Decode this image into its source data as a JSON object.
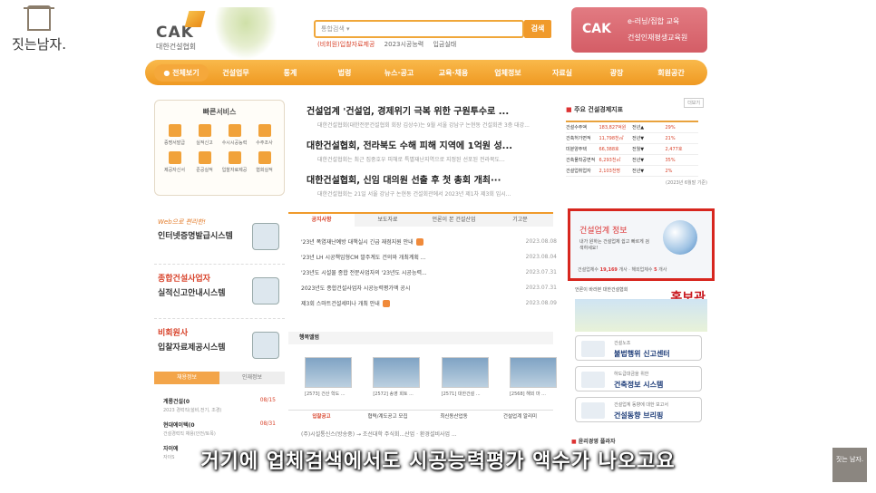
{
  "channel": {
    "name": "짓는남자.",
    "corner_label": "짓는 남자."
  },
  "header": {
    "logo_text": "CAK",
    "logo_sub": "대한건설협회",
    "search_placeholder": "통합검색 ▾",
    "search_button": "검색",
    "search_links": [
      "(비회원)입찰자료제공",
      "2023시공능력",
      "입금실태"
    ],
    "edu_banner": {
      "logo": "CAK",
      "line1": "e-러닝/집합 교육",
      "line2": "건설인재평생교육원"
    }
  },
  "nav": [
    "● 전체보기",
    "건설업무",
    "통계",
    "법령",
    "뉴스·공고",
    "교육·채용",
    "업체정보",
    "자료실",
    "광장",
    "회원공간"
  ],
  "quick_service": {
    "title": "빠른서비스",
    "items": [
      "증명서발급",
      "실적신고",
      "수시시공능력",
      "수주조사",
      "제공자신서",
      "준공실적",
      "입찰자료제공",
      "협회실적"
    ]
  },
  "news": [
    {
      "title": "건설업계 '건설업, 경제위기 극복 위한 구원투수로 ...",
      "desc": "대한건설협회(대한전문건설협회 회장 김상수)는 9월 서울 강남구 논현동 건설회관 3층 대강..."
    },
    {
      "title": "대한건설협회, 전라북도 수해 피해 지역에 1억원 성...",
      "desc": "대한건설협회는 최근 집중호우 피해로 특별재난지역으로 지정된 선포된 전라북도..."
    },
    {
      "title": "대한건설협회, 신임 대의원 선출 후 첫 총회 개최···",
      "desc": "대한건설협회는 21일 서울 강남구 논현동 건설회관에서 2023년 제1차 제3회 임시..."
    }
  ],
  "stats": {
    "title": "주요 건설경제지표",
    "more": "더보기",
    "rows": [
      {
        "label": "건설수주액",
        "value": "183,827억원",
        "cmp": "전년▲",
        "pct": "29%"
      },
      {
        "label": "건축허가면적",
        "value": "11,798천㎡",
        "cmp": "전년▼",
        "pct": "21%"
      },
      {
        "label": "미분양주택",
        "value": "66,388호",
        "cmp": "전월▼",
        "pct": "2,477호"
      },
      {
        "label": "건축물착공면적",
        "value": "6,293천㎡",
        "cmp": "전년▼",
        "pct": "35%"
      },
      {
        "label": "건설업취업자",
        "value": "2,103천명",
        "cmp": "전년▼",
        "pct": "2%"
      }
    ],
    "note": "(2023년 6월말 기준)"
  },
  "red_banner": {
    "title": "건설업계 정보",
    "desc": "내가 원하는 건설업체 쉽고 빠르게 검색하세요!",
    "footer_prefix": "건설업체수",
    "footer_count": "19,169",
    "footer_mid": "개사 · 해외업체수",
    "footer_count2": "5",
    "footer_suffix": "개사"
  },
  "left_banners": [
    {
      "small": "Web으로 편리한!",
      "big": "인터넷증명발급시스템"
    },
    {
      "small": "종합건설사업자",
      "big": "실적신고안내시스템"
    },
    {
      "small": "비회원사",
      "big": "입찰자료제공시스템"
    }
  ],
  "notice_tabs": [
    "공지사항",
    "보도자료",
    "언론이 본 건설산업",
    "기고문"
  ],
  "notices": [
    {
      "text": "'23년 폭염재난예방 대책실시 긴급 재점지원 안내",
      "date": "2023.08.08"
    },
    {
      "text": "'23년 LH 시공책임형CM 발주계도 건의와 개최계획 ...",
      "date": "2023.08.04"
    },
    {
      "text": "'23년도 시설물 종합 전문사업자의 '23년도 시공능력...",
      "date": "2023.07.31"
    },
    {
      "text": "2023년도 종합건설사업자 시공능력평가액 공시",
      "date": "2023.07.31"
    },
    {
      "text": "제3회 스마트건설세미나 개최 안내",
      "date": "2023.08.09"
    }
  ],
  "photo_head": "행복앨범",
  "photos": [
    "[2573] 건산 학도 ...",
    "[2572] 송영 회토 ...",
    "[2571] 대한건설 ...",
    "[2568] 해외 마 ..."
  ],
  "bottom_tabs": [
    "입찰공고",
    "협력/계도공고 모집",
    "최신동산업동",
    "건설업계 알리미"
  ],
  "bottom_line": "(주)시설통신스(방송중) → 조선대학 주식회...산업 · 환경설비사업 ...",
  "left_tabs": [
    "채용정보",
    "인재정보"
  ],
  "left_list": [
    {
      "title": "계룡건설(0",
      "num": "08/15",
      "sub": "2023 경력직(설비,전기, 조경)"
    },
    {
      "title": "현대에이텍(0",
      "num": "08/31",
      "sub": "건설경력직 채용(안전/토목)"
    },
    {
      "title": "자이에",
      "num": "",
      "sub": "자이S"
    }
  ],
  "pr": {
    "small": "언론이 바라본 대한건설협회",
    "big": "홍보관"
  },
  "right_cards": [
    {
      "t1": "건설노조",
      "t2": "불법행위 신고센터"
    },
    {
      "t1": "하도급대금을 위한",
      "t2": "건축정보 시스템"
    },
    {
      "t1": "건설업계 동향에 대한 보고서",
      "t2": "건설동향 브리핑"
    }
  ],
  "ethics": "윤리경영 플라자",
  "subtitle": "거기에 업체검색에서도 시공능력평가 액수가 나오고요"
}
